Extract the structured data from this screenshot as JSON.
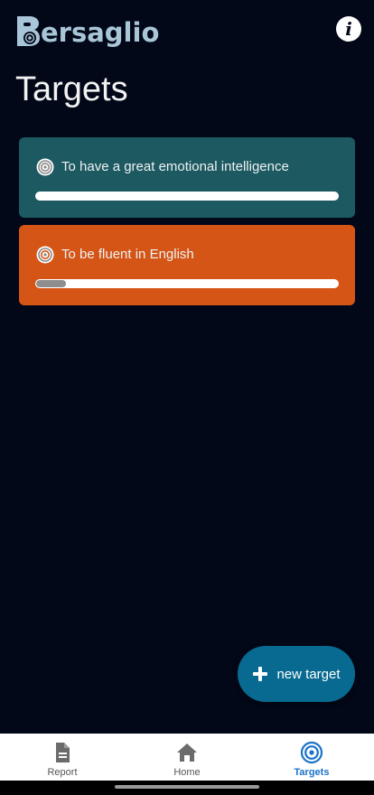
{
  "app": {
    "logo_text": "ersaglio",
    "logo_letter": "B",
    "info_icon": "info-icon",
    "info_glyph": "i"
  },
  "page": {
    "title": "Targets"
  },
  "targets": [
    {
      "label": "To have a great emotional intelligence",
      "color": "#1d5961",
      "progress": 0.0,
      "icon": "target-icon"
    },
    {
      "label": "To be fluent in English",
      "color": "#d55516",
      "progress": 0.1,
      "icon": "target-icon"
    }
  ],
  "fab": {
    "label": "new target",
    "icon": "plus-icon",
    "color": "#096a91"
  },
  "nav": {
    "items": [
      {
        "label": "Report",
        "icon": "report-icon",
        "active": false
      },
      {
        "label": "Home",
        "icon": "home-icon",
        "active": false
      },
      {
        "label": "Targets",
        "icon": "target-icon",
        "active": true
      }
    ],
    "active_color": "#1a73c9"
  }
}
